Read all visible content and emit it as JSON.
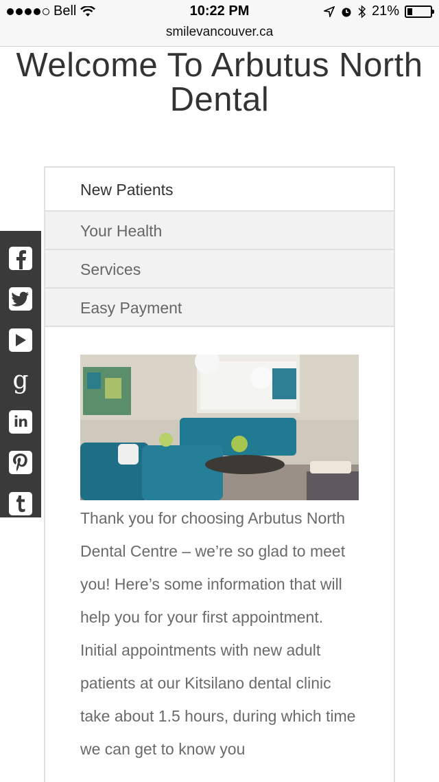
{
  "status_bar": {
    "carrier": "Bell",
    "time": "10:22 PM",
    "battery": "21%",
    "battery_level": 0.21
  },
  "browser": {
    "url": "smilevancouver.ca"
  },
  "page": {
    "title": "Welcome To Arbutus North Dental",
    "tabs": [
      {
        "label": "New Patients",
        "active": true
      },
      {
        "label": "Your Health",
        "active": false
      },
      {
        "label": "Services",
        "active": false
      },
      {
        "label": "Easy Payment",
        "active": false
      }
    ],
    "body": "Thank you for choosing Arbutus North Dental Centre – we’re so glad to meet you! Here’s some information that will help you for your first appointment. Initial appointments with new adult patients at our Kitsilano dental clinic take about 1.5 hours, during which time we can get to know you"
  },
  "social": [
    {
      "name": "facebook-icon",
      "glyph": "f"
    },
    {
      "name": "twitter-icon",
      "glyph": "t"
    },
    {
      "name": "youtube-icon",
      "glyph": "▶"
    },
    {
      "name": "google-plus-icon",
      "glyph": "g"
    },
    {
      "name": "linkedin-icon",
      "glyph": "in"
    },
    {
      "name": "pinterest-icon",
      "glyph": "P"
    },
    {
      "name": "tumblr-icon",
      "glyph": "t"
    }
  ],
  "colors": {
    "sidebar": "#3a3a3a",
    "tab_bg": "#f2f2f2",
    "border": "#e0e0e0"
  }
}
